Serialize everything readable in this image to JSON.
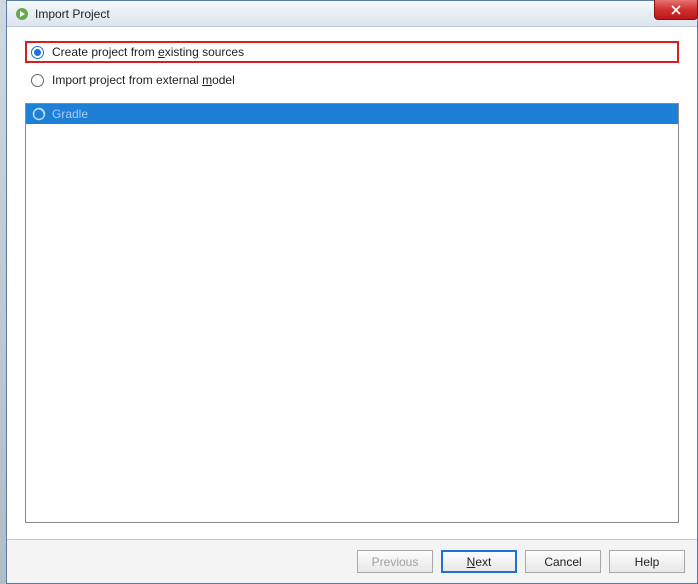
{
  "window": {
    "title": "Import Project"
  },
  "options": {
    "create_from_existing": "Create project from existing sources",
    "import_from_model": "Import project from external model",
    "selected": "create_from_existing"
  },
  "models": {
    "items": [
      {
        "label": "Gradle"
      }
    ]
  },
  "buttons": {
    "previous": "Previous",
    "next": "Next",
    "cancel": "Cancel",
    "help": "Help"
  }
}
